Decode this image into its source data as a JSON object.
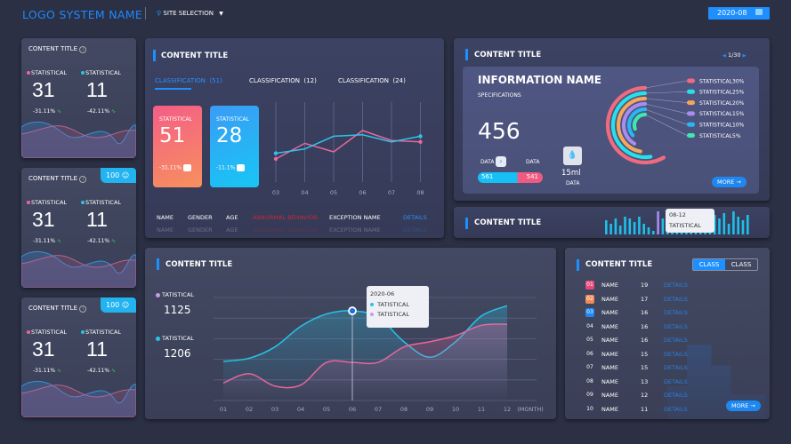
{
  "header": {
    "logo": "LOGO SYSTEM NAME",
    "site_selection": "SITE SELECTION",
    "date": "2020-08",
    "icons": [
      "location-pin-icon",
      "caret-down-icon",
      "calendar-icon"
    ]
  },
  "left_cards": [
    {
      "title": "CONTENT TITLE",
      "badge": null,
      "stats": [
        {
          "label": "STATISTICAL",
          "value": "31",
          "change": "-31.11%"
        },
        {
          "label": "STATISTICAL",
          "value": "11",
          "change": "-42.11%"
        }
      ]
    },
    {
      "title": "CONTENT TITLE",
      "badge": "100",
      "badge_icon": "group-icon",
      "stats": [
        {
          "label": "STATISTICAL",
          "value": "31",
          "change": "-31.11%"
        },
        {
          "label": "STATISTICAL",
          "value": "11",
          "change": "-42.11%"
        }
      ]
    },
    {
      "title": "CONTENT TITLE",
      "badge": "100",
      "badge_icon": "user-icon",
      "stats": [
        {
          "label": "STATISTICAL",
          "value": "31",
          "change": "-31.11%"
        },
        {
          "label": "STATISTICAL",
          "value": "11",
          "change": "-42.11%"
        }
      ]
    }
  ],
  "center_top": {
    "title": "CONTENT TITLE",
    "tabs": [
      {
        "label": "CLASSIFICATION",
        "count": "(51)",
        "active": true
      },
      {
        "label": "CLASSIFICATION",
        "count": "(12)"
      },
      {
        "label": "CLASSIFICATION",
        "count": "(24)"
      }
    ],
    "cards": [
      {
        "label": "STATISTICAL",
        "value": "51",
        "change": "-31.11%"
      },
      {
        "label": "STATISTICAL",
        "value": "28",
        "change": "-11.1%"
      }
    ],
    "table_headers": [
      "NAME",
      "GENDER",
      "AGE",
      "ABNORMAL BEHAVIOR",
      "EXCEPTION NAME",
      "DETAILS"
    ]
  },
  "chart_data": [
    {
      "type": "line",
      "categories": [
        "03",
        "04",
        "05",
        "06",
        "07",
        "08"
      ],
      "series": [
        {
          "color": "#e8679d",
          "values": [
            20,
            42,
            30,
            60,
            46,
            44
          ]
        },
        {
          "color": "#2fc3e8",
          "values": [
            28,
            34,
            52,
            54,
            44,
            52
          ]
        }
      ],
      "ylim": [
        0,
        100
      ],
      "grid": "vertical"
    },
    {
      "type": "area",
      "categories": [
        "01",
        "02",
        "03",
        "04",
        "05",
        "06",
        "07",
        "08",
        "09",
        "10",
        "11",
        "12"
      ],
      "xlabel": "(MONTH)",
      "ylim": [
        0,
        5
      ],
      "grid": "horizontal",
      "series": [
        {
          "color": "#27c4e8",
          "values": [
            1.9,
            2.05,
            2.6,
            3.6,
            4.2,
            4.35,
            4.05,
            2.85,
            2.1,
            2.85,
            4.1,
            4.6
          ]
        },
        {
          "color": "#e8679d",
          "values": [
            0.85,
            1.3,
            0.7,
            0.75,
            1.85,
            1.85,
            1.85,
            2.6,
            2.85,
            3.15,
            3.65,
            3.7
          ]
        }
      ],
      "tooltip": {
        "title": "2020-06",
        "items": [
          "TATISTICAL",
          "TATISTICAL"
        ]
      }
    },
    {
      "type": "bar",
      "values": [
        8,
        6,
        9,
        5,
        10,
        9,
        7,
        10,
        6,
        4,
        2,
        13,
        9,
        7,
        6,
        8,
        7,
        9,
        10,
        11,
        8,
        10,
        4,
        11,
        9,
        12,
        6,
        13,
        10,
        8,
        11
      ],
      "color": "#1ec0ea",
      "tooltip": {
        "title": "08-12",
        "label": "TATISTICAL"
      }
    },
    {
      "type": "pie",
      "style": "radial-arcs",
      "series": [
        {
          "name": "STATISTICAL",
          "value": 30,
          "color": "#f06b7e"
        },
        {
          "name": "STATISTICAL",
          "value": 25,
          "color": "#27e0e8"
        },
        {
          "name": "STATISTICAL",
          "value": 20,
          "color": "#f5a75b"
        },
        {
          "name": "STATISTICAL",
          "value": 15,
          "color": "#a98cf0"
        },
        {
          "name": "STATISTICAL",
          "value": 10,
          "color": "#2ab6ef"
        },
        {
          "name": "STATISTICAL",
          "value": 5,
          "color": "#3ee8b0"
        }
      ]
    }
  ],
  "right_top": {
    "title": "CONTENT TITLE",
    "pager": "1/30",
    "info_name": "INFORMATION NAME",
    "specifications": "SPECIFICATIONS",
    "value": "456",
    "data_left_label": "DATA",
    "data_right_label": "DATA",
    "data_left": "561",
    "data_right": "541",
    "volume": "15ml",
    "volume_label": "DATA",
    "legend_pcts": [
      "30%",
      "25%",
      "20%",
      "15%",
      "10%",
      "5%"
    ],
    "more": "MORE →"
  },
  "right_mid": {
    "title": "CONTENT TITLE"
  },
  "bottom_center": {
    "title": "CONTENT TITLE",
    "legend": [
      {
        "label": "TATISTICAL",
        "value": "1125",
        "color": "#c79be8"
      },
      {
        "label": "TATISTICAL",
        "value": "1206",
        "color": "#27c4e8"
      }
    ]
  },
  "bottom_right": {
    "title": "CONTENT TITLE",
    "toggle": [
      "CLASS",
      "CLASS"
    ],
    "more": "MORE →",
    "rows": [
      [
        "01",
        "NAME",
        "19",
        "DETAILS"
      ],
      [
        "02",
        "NAME",
        "17",
        "DETAILS"
      ],
      [
        "03",
        "NAME",
        "16",
        "DETAILS"
      ],
      [
        "04",
        "NAME",
        "16",
        "DETAILS"
      ],
      [
        "05",
        "NAME",
        "16",
        "DETAILS"
      ],
      [
        "06",
        "NAME",
        "15",
        "DETAILS"
      ],
      [
        "07",
        "NAME",
        "15",
        "DETAILS"
      ],
      [
        "08",
        "NAME",
        "13",
        "DETAILS"
      ],
      [
        "09",
        "NAME",
        "12",
        "DETAILS"
      ],
      [
        "10",
        "NAME",
        "11",
        "DETAILS"
      ]
    ]
  },
  "colors": {
    "accent": "#1e8fff",
    "pink": "#e8679d",
    "cyan": "#27c4e8",
    "abnormal": "#c8283c"
  }
}
